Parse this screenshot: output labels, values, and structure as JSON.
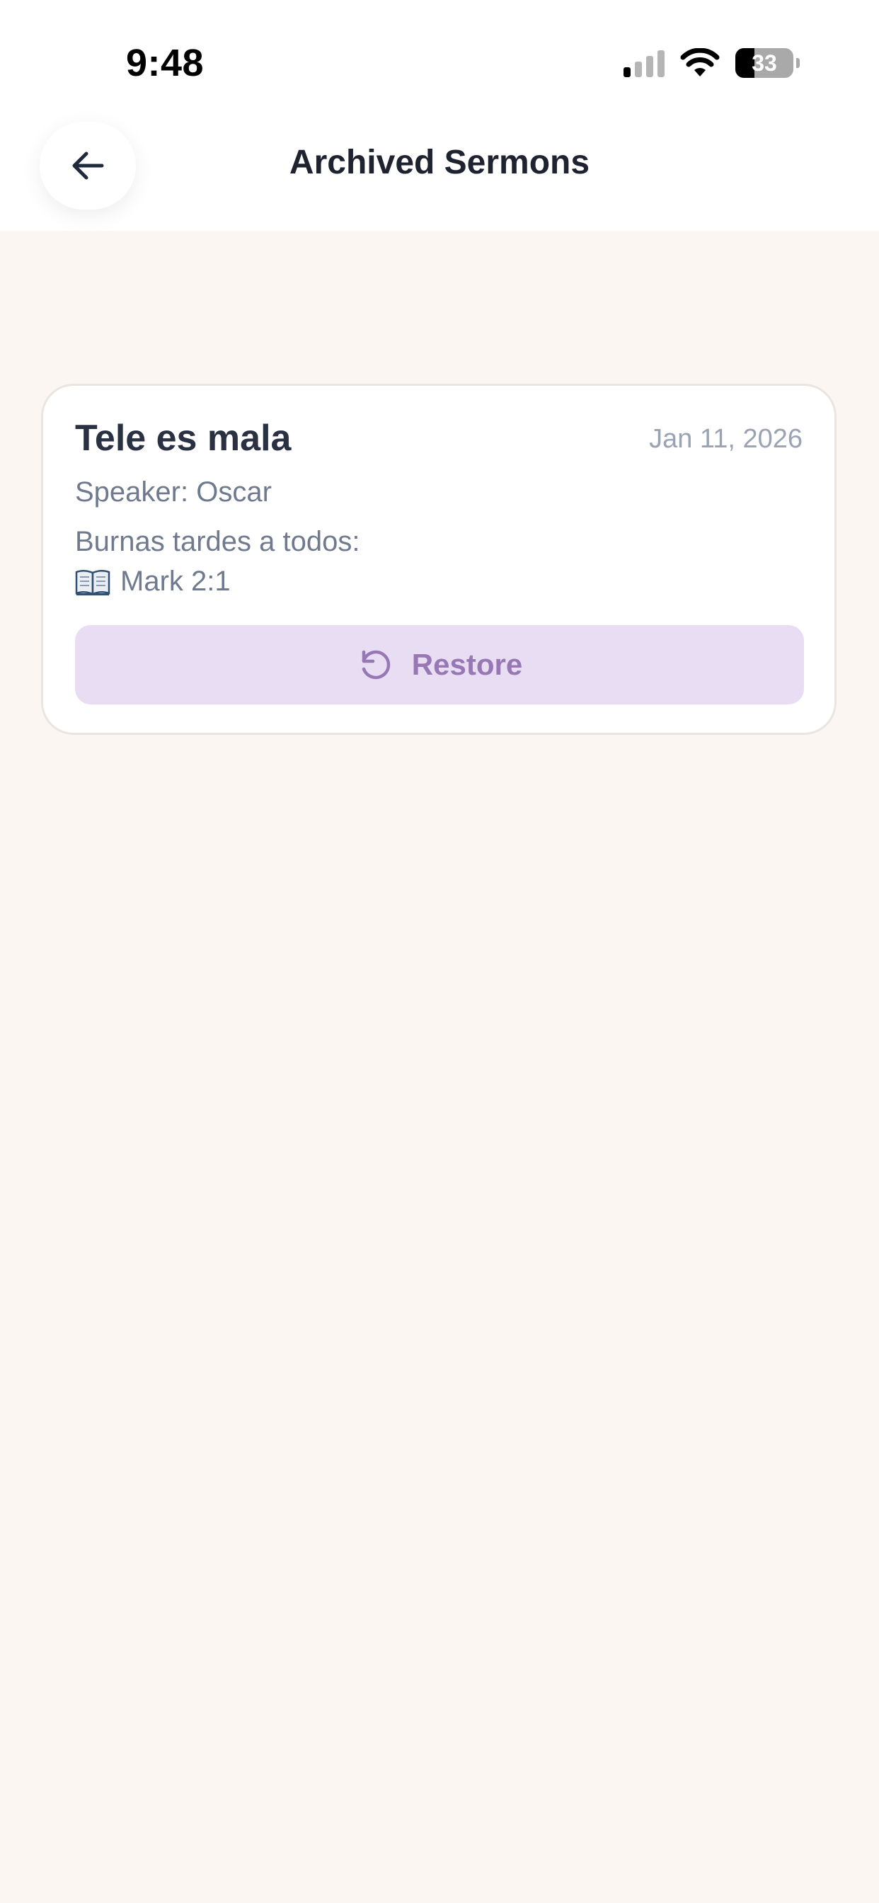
{
  "status_bar": {
    "time": "9:48",
    "battery_level": "33",
    "icons": [
      "cellular-signal-icon",
      "wifi-icon",
      "battery-icon"
    ]
  },
  "header": {
    "title": "Archived Sermons",
    "back_icon": "arrow-left-icon"
  },
  "sermons": [
    {
      "title": "Tele es mala",
      "date": "Jan 11, 2026",
      "speaker": "Speaker: Oscar",
      "description": "Burnas tardes a todos:",
      "scripture": "Mark 2:1",
      "scripture_icon": "open-book-icon",
      "restore_label": "Restore",
      "restore_icon": "restore-icon"
    }
  ],
  "colors": {
    "background": "#fbf6f1",
    "accent": "#9878b4",
    "accent_bg": "#e8ddf3",
    "title_text": "#1f2330",
    "secondary_text": "#6f7a8e"
  }
}
